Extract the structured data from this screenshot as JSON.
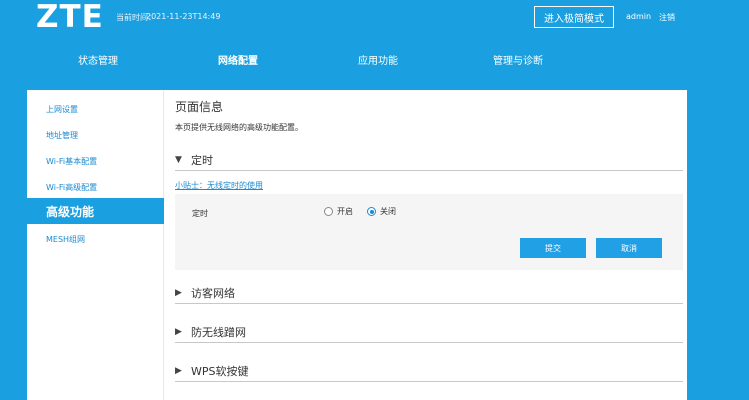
{
  "header": {
    "logo": "ZTE",
    "time_label": "当前时间：",
    "time_value": "2021-11-23T14:49",
    "expert_mode_label": "进入极简模式",
    "username": "admin",
    "logout_label": "注销"
  },
  "nav": {
    "items": [
      {
        "label": "状态管理"
      },
      {
        "label": "网络配置"
      },
      {
        "label": "应用功能"
      },
      {
        "label": "管理与诊断"
      }
    ],
    "active": "网络配置"
  },
  "sidebar": {
    "items": [
      {
        "label": "上网设置"
      },
      {
        "label": "地址管理"
      },
      {
        "label": "Wi-Fi基本配置"
      },
      {
        "label": "Wi-Fi高级配置"
      },
      {
        "label": "高级功能"
      },
      {
        "label": "MESH组网"
      }
    ],
    "active": "高级功能"
  },
  "main": {
    "title": "页面信息",
    "description": "本页提供无线网络的高级功能配置。",
    "sections": [
      {
        "label": "定时",
        "expanded": true
      },
      {
        "label": "访客网络",
        "expanded": false
      },
      {
        "label": "防无线蹭网",
        "expanded": false
      },
      {
        "label": "WPS软按键",
        "expanded": false
      }
    ],
    "tip_link": "小贴士：无线定时的使用",
    "timer": {
      "label": "定时",
      "options": [
        {
          "label": "开启",
          "checked": false
        },
        {
          "label": "关闭",
          "checked": true
        }
      ],
      "submit_label": "提交",
      "cancel_label": "取消"
    }
  },
  "icons": {
    "expanded": "▼",
    "collapsed": "▶"
  },
  "colors": {
    "brand_blue": "#1aa0e0",
    "button_blue": "#22a0e6",
    "link_blue": "#1a8ad2"
  }
}
